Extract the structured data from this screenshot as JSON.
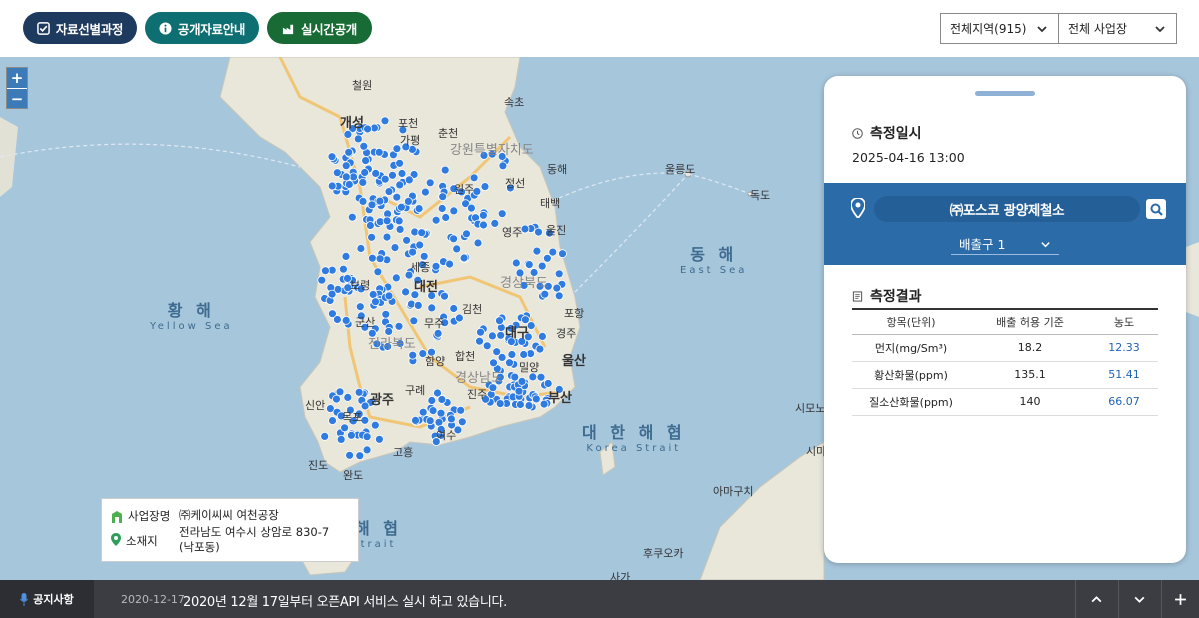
{
  "toolbar": {
    "btn_select_process": "자료선별과정",
    "btn_public_guide": "공개자료안내",
    "btn_realtime": "실시간공개",
    "region_select": "전체지역(915)",
    "site_select": "전체 사업장"
  },
  "map": {
    "labels": {
      "kaesong": "개성",
      "chuncheon": "춘천",
      "gangwon": "강원특별자치도",
      "ulleungdo": "울릉도",
      "dokdo": "독도",
      "wonju": "원주",
      "yeongju": "영주",
      "daejeon": "대전",
      "gyeongbuk": "경상북도",
      "pohang": "포항",
      "gyeongju": "경주",
      "daegu": "대구",
      "jeonbuk": "전라북도",
      "ulsan": "울산",
      "gyeongnam": "경상남도",
      "busan": "부산",
      "gwangju": "광주",
      "yeosu": "여수",
      "goheung": "고흥",
      "jindo": "진도",
      "wando": "완도",
      "mokpo": "목포",
      "sinan": "신안",
      "jeongseon": "정선",
      "taebaek": "태백",
      "uljin": "울진",
      "donghae": "동해",
      "sokcho": "속초",
      "cheorwon": "철원",
      "sejong": "세종",
      "boryeong": "보령",
      "gunsan": "군산",
      "gimcheon": "김천",
      "muju": "무주",
      "jinju": "진주",
      "miryang": "밀양",
      "pocheon": "포천",
      "gapyeong": "가평",
      "hapcheon": "합천",
      "hamyang": "함양",
      "gurye": "구례",
      "tsushima": "시모노세키",
      "shimane": "시마네",
      "fukuoka": "후쿠오카",
      "amagi": "아마구치",
      "saga": "사가"
    },
    "seas": {
      "yellow_ko": "황 해",
      "yellow_en": "Yellow Sea",
      "east_ko": "동 해",
      "east_en": "East Sea",
      "korea_strait_ko": "대 한 해 협",
      "korea_strait_en": "Korea Strait",
      "strait_partial_ko": "해 협",
      "strait_partial_en": "trait"
    },
    "zoom_in": "+",
    "zoom_out": "−"
  },
  "info_popup": {
    "name_label": "사업장명",
    "name_value": "㈜케이씨씨 여천공장",
    "address_label": "소재지",
    "address_line1": "전라남도 여수시 상암로 830-7",
    "address_line2": "(낙포동)"
  },
  "panel": {
    "measure_time_title": "측정일시",
    "measure_time": "2025-04-16 13:00",
    "site_name": "㈜포스코 광양제철소",
    "outlet": "배출구 1",
    "result_title": "측정결과",
    "table": {
      "headers": [
        "항목(단위)",
        "배출 허용 기준",
        "농도"
      ],
      "rows": [
        {
          "item": "먼지(mg/Sm³)",
          "limit": "18.2",
          "conc": "12.33"
        },
        {
          "item": "황산화물(ppm)",
          "limit": "135.1",
          "conc": "51.41"
        },
        {
          "item": "질소산화물(ppm)",
          "limit": "140",
          "conc": "66.07"
        }
      ]
    }
  },
  "notice": {
    "label": "공지사항",
    "date": "2020-12-17",
    "text": "2020년 12월 17일부터 오픈API 서비스 실시 하고 있습니다."
  },
  "colors": {
    "navy": "#1f3a5f",
    "teal": "#0e6f72",
    "green": "#186b34",
    "panel_blue": "#2b6ca8",
    "marker_blue": "#2f7be0",
    "sea": "#a6c6dc",
    "land": "#e9e6da"
  }
}
